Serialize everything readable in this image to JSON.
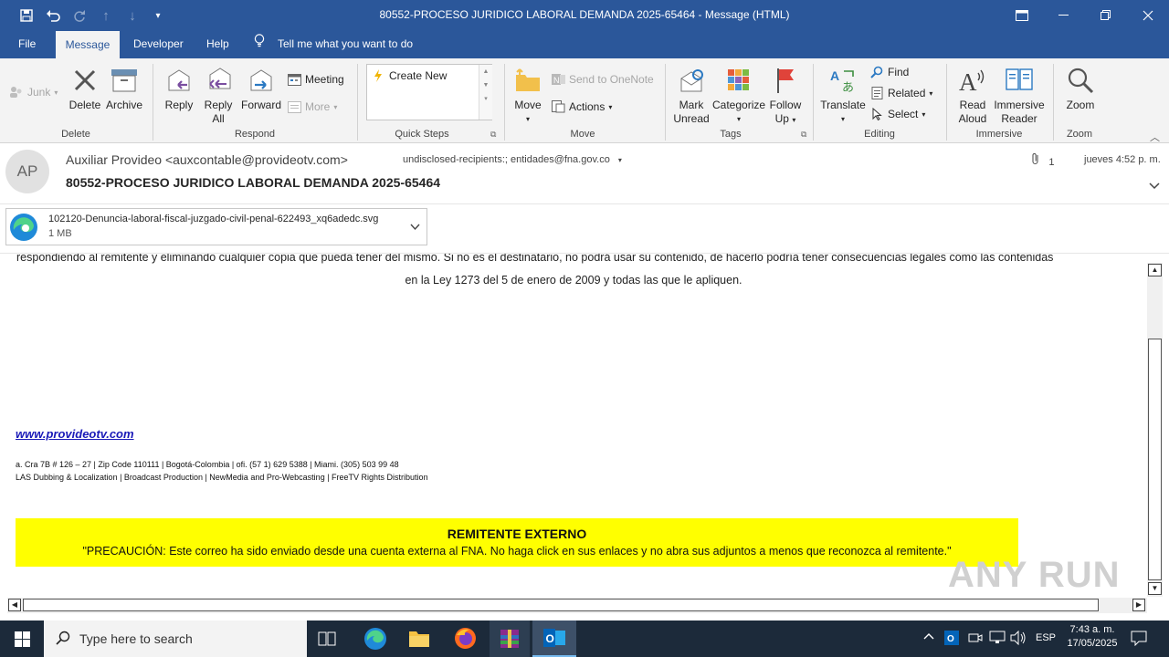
{
  "window": {
    "title": "80552-PROCESO JURIDICO LABORAL DEMANDA 2025-65464  -  Message (HTML)"
  },
  "tabs": [
    "File",
    "Message",
    "Developer",
    "Help"
  ],
  "tell_me": "Tell me what you want to do",
  "ribbon": {
    "delete_group": {
      "junk": "Junk",
      "delete": "Delete",
      "archive": "Archive",
      "label": "Delete"
    },
    "respond_group": {
      "reply": "Reply",
      "reply_all_1": "Reply",
      "reply_all_2": "All",
      "forward": "Forward",
      "meeting": "Meeting",
      "more": "More",
      "label": "Respond"
    },
    "quick_steps": {
      "create_new": "Create New",
      "label": "Quick Steps"
    },
    "move_group": {
      "move": "Move",
      "onenote": "Send to OneNote",
      "actions": "Actions",
      "label": "Move"
    },
    "tags_group": {
      "mark_1": "Mark",
      "mark_2": "Unread",
      "categorize": "Categorize",
      "follow_1": "Follow",
      "follow_2": "Up",
      "label": "Tags"
    },
    "editing_group": {
      "translate": "Translate",
      "find": "Find",
      "related": "Related",
      "select": "Select",
      "label": "Editing"
    },
    "immersive_group": {
      "read_1": "Read",
      "read_2": "Aloud",
      "immersive_1": "Immersive",
      "immersive_2": "Reader",
      "label": "Immersive"
    },
    "zoom_group": {
      "zoom": "Zoom",
      "label": "Zoom"
    }
  },
  "message": {
    "avatar": "AP",
    "from": "Auxiliar Provideo <auxcontable@provideotv.com>",
    "to": "undisclosed-recipients:; entidades@fna.gov.co",
    "attachment_count": "1",
    "time": "jueves 4:52 p. m.",
    "subject": "80552-PROCESO JURIDICO LABORAL DEMANDA 2025-65464"
  },
  "attachment": {
    "name": "102120-Denuncia-laboral-fiscal-juzgado-civil-penal-622493_xq6adedc.svg",
    "size": "1 MB"
  },
  "body": {
    "cut_line": "respondiendo al remitente y eliminando cualquier copia que pueda tener del mismo. Si no es el destinatario, no podrá usar su contenido, de hacerlo podría tener consecuencias legales como las contenidas",
    "law_line": "en la Ley 1273  del 5 de enero de 2009  y todas las que le apliquen.",
    "website": "www.provideotv.com",
    "address": "a. Cra 7B # 126 – 27 | Zip Code 110111 | Bogotá-Colombia | ofi. (57 1) 629 5388 | Miami. (305) 503 99 48",
    "services": "LAS Dubbing & Localization | Broadcast Production | NewMedia and Pro-Webcasting | FreeTV Rights Distribution",
    "banner_title": "REMITENTE EXTERNO",
    "banner_text": "\"PRECAUCIÓN: Este correo ha sido enviado desde una cuenta externa al FNA. No haga click  en sus enlaces y no abra sus adjuntos a menos que reconozca al remitente.\""
  },
  "taskbar": {
    "search_placeholder": "Type here to search",
    "lang": "ESP",
    "time": "7:43 a. m.",
    "date": "17/05/2025"
  },
  "watermark": "ANY RUN",
  "colors": {
    "accent": "#2b579a",
    "banner": "#ffff00",
    "taskbar": "#1c2a3a"
  }
}
